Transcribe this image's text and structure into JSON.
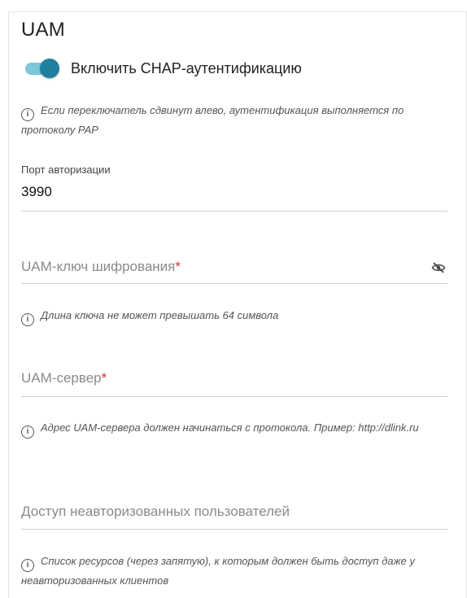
{
  "section": {
    "title": "UAM"
  },
  "chap_toggle": {
    "label": "Включить CHAP-аутентификацию",
    "enabled": true
  },
  "hints": {
    "chap": "Если переключатель сдвинут влево, аутентификация выполняется по протоколу PAP",
    "key_length": "Длина ключа не может превышать 64 символа",
    "server": "Адрес UAM-сервера должен начинаться с протокола. Пример: http://dlink.ru",
    "unauth": "Список ресурсов (через запятую), к которым должен быть доступ даже у неавторизованных клиентов"
  },
  "fields": {
    "auth_port": {
      "label": "Порт авторизации",
      "value": "3990"
    },
    "uam_key": {
      "placeholder": "UAM-ключ шифрования",
      "required_mark": "*"
    },
    "uam_server": {
      "placeholder": "UAM-сервер",
      "required_mark": "*"
    },
    "unauth_access": {
      "placeholder": "Доступ неавторизованных пользователей"
    }
  },
  "icons": {
    "info": "info-icon",
    "eye_off": "eye-off-icon"
  },
  "colors": {
    "toggle_track": "#7cc7d8",
    "toggle_knob": "#1f7f9f",
    "required": "#d32f2f"
  }
}
